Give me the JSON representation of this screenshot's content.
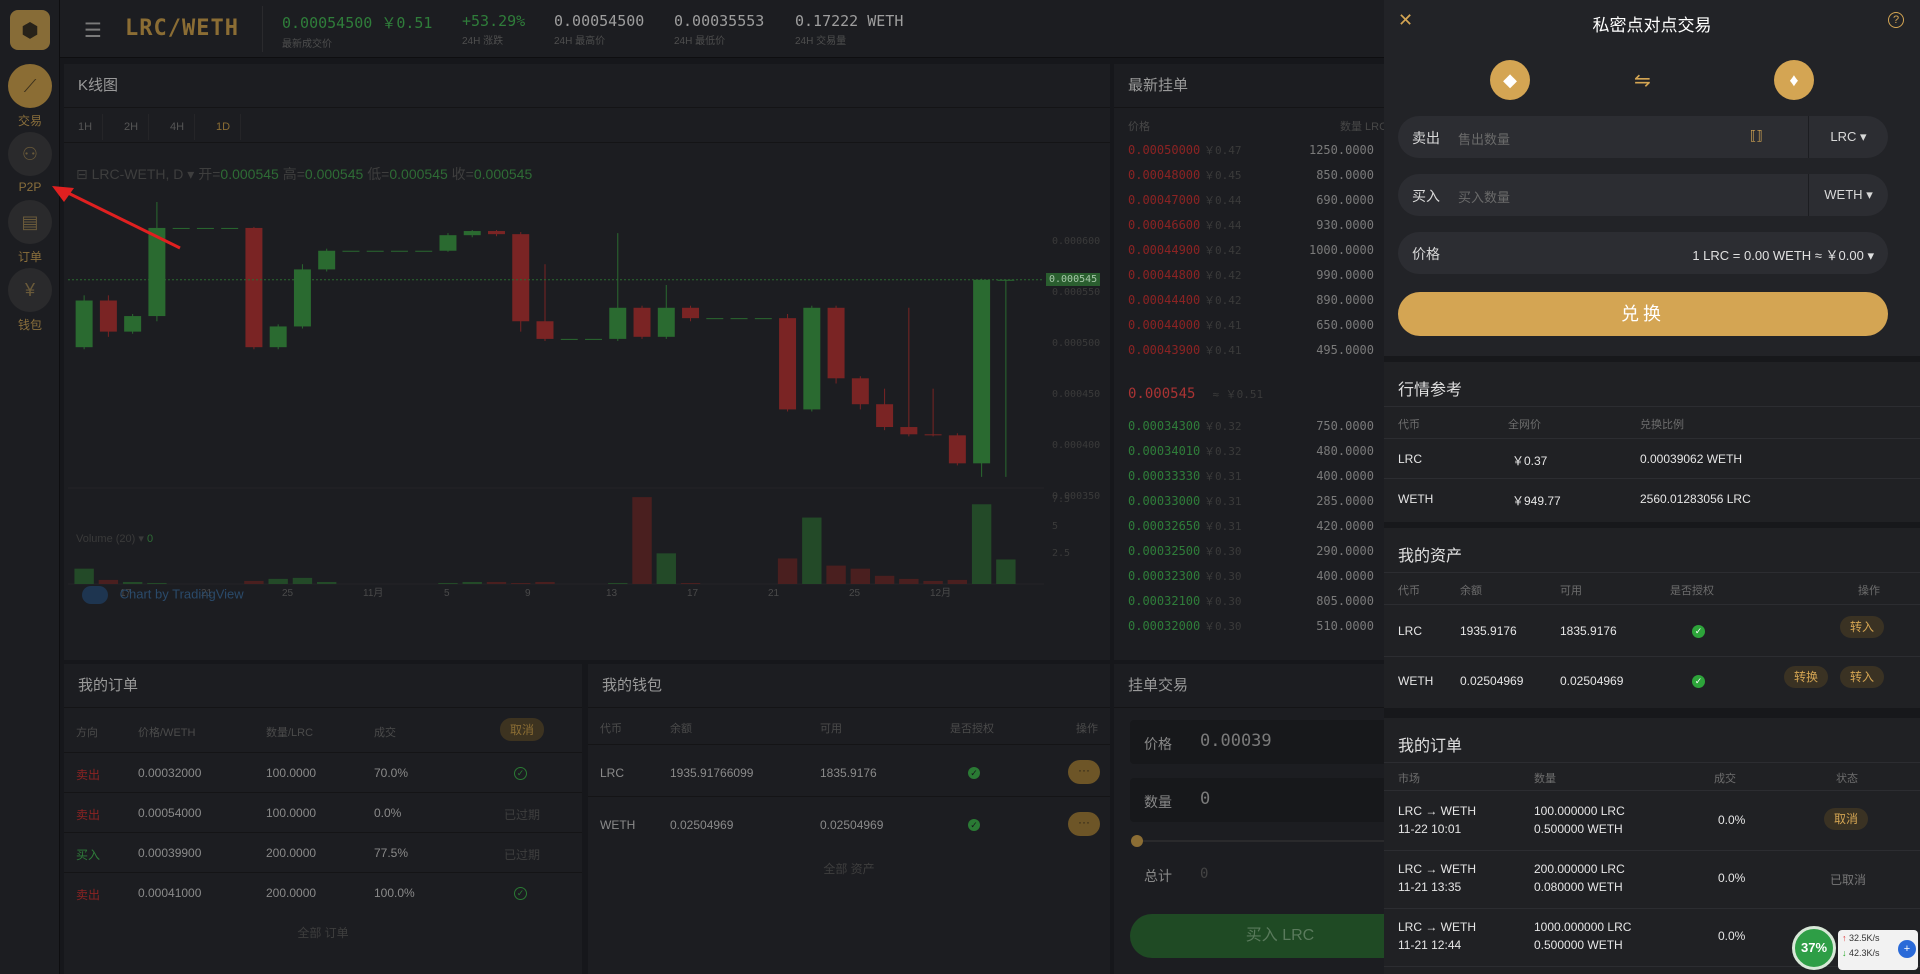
{
  "rail": {
    "items": [
      {
        "label": "交易"
      },
      {
        "label": "P2P"
      },
      {
        "label": "订单"
      },
      {
        "label": "钱包"
      }
    ]
  },
  "topbar": {
    "pair": "LRC/WETH",
    "stats": [
      {
        "value": "0.00054500 ￥0.51",
        "label": "最新成交价"
      },
      {
        "value": "+53.29%",
        "label": "24H 涨跌"
      },
      {
        "value": "0.00054500",
        "label": "24H 最高价"
      },
      {
        "value": "0.00035553",
        "label": "24H 最低价"
      },
      {
        "value": "0.17222 WETH",
        "label": "24H 交易量"
      }
    ]
  },
  "chart": {
    "title": "K线图",
    "timeframes": [
      "1H",
      "2H",
      "4H",
      "1D"
    ],
    "symbol": "LRC-WETH, D",
    "ohlc": {
      "o_label": "开=",
      "o": "0.000545",
      "h_label": "高=",
      "h": "0.000545",
      "l_label": "低=",
      "l": "0.000545",
      "c_label": "收=",
      "c": "0.000545"
    },
    "volume_label": "Volume (20)",
    "volume_value": "0",
    "watermark": "Chart by TradingView",
    "last_price_tag": "0.000545",
    "y_ticks": [
      "0.000600",
      "0.000550",
      "0.000500",
      "0.000450",
      "0.000400",
      "0.000350"
    ],
    "vol_ticks": [
      "7.5",
      "5",
      "2.5"
    ],
    "x_ticks": [
      "17",
      "21",
      "25",
      "11月",
      "5",
      "9",
      "13",
      "17",
      "21",
      "25",
      "12月"
    ]
  },
  "chart_data": {
    "type": "candlestick",
    "ylim": [
      0.00035,
      0.00062
    ],
    "candles": [
      {
        "o": 0.00048,
        "c": 0.000525,
        "h": 0.00053,
        "l": 0.000478
      },
      {
        "o": 0.000525,
        "c": 0.000495,
        "h": 0.00053,
        "l": 0.00049
      },
      {
        "o": 0.000495,
        "c": 0.00051,
        "h": 0.000512,
        "l": 0.000493
      },
      {
        "o": 0.00051,
        "c": 0.000595,
        "h": 0.00062,
        "l": 0.000505
      },
      {
        "o": 0.000595,
        "c": 0.000595,
        "h": 0.000595,
        "l": 0.000595
      },
      {
        "o": 0.000595,
        "c": 0.000595,
        "h": 0.000595,
        "l": 0.000595
      },
      {
        "o": 0.000595,
        "c": 0.000595,
        "h": 0.000595,
        "l": 0.000595
      },
      {
        "o": 0.000595,
        "c": 0.00048,
        "h": 0.000596,
        "l": 0.000478
      },
      {
        "o": 0.00048,
        "c": 0.0005,
        "h": 0.000502,
        "l": 0.000478
      },
      {
        "o": 0.0005,
        "c": 0.000555,
        "h": 0.00056,
        "l": 0.000498
      },
      {
        "o": 0.000555,
        "c": 0.000573,
        "h": 0.000575,
        "l": 0.000553
      },
      {
        "o": 0.000573,
        "c": 0.000573,
        "h": 0.000573,
        "l": 0.000573
      },
      {
        "o": 0.000573,
        "c": 0.000573,
        "h": 0.000573,
        "l": 0.000573
      },
      {
        "o": 0.000573,
        "c": 0.000573,
        "h": 0.000573,
        "l": 0.000573
      },
      {
        "o": 0.000573,
        "c": 0.000573,
        "h": 0.000573,
        "l": 0.000573
      },
      {
        "o": 0.000573,
        "c": 0.000588,
        "h": 0.00059,
        "l": 0.000572
      },
      {
        "o": 0.000588,
        "c": 0.000592,
        "h": 0.000593,
        "l": 0.000586
      },
      {
        "o": 0.000592,
        "c": 0.000589,
        "h": 0.000593,
        "l": 0.000587
      },
      {
        "o": 0.000589,
        "c": 0.000505,
        "h": 0.000591,
        "l": 0.000495
      },
      {
        "o": 0.000505,
        "c": 0.000488,
        "h": 0.00056,
        "l": 0.000486
      },
      {
        "o": 0.000488,
        "c": 0.000488,
        "h": 0.000488,
        "l": 0.000488
      },
      {
        "o": 0.000488,
        "c": 0.000488,
        "h": 0.000488,
        "l": 0.000488
      },
      {
        "o": 0.000488,
        "c": 0.000518,
        "h": 0.00059,
        "l": 0.000486
      },
      {
        "o": 0.000518,
        "c": 0.00049,
        "h": 0.00052,
        "l": 0.000488
      },
      {
        "o": 0.00049,
        "c": 0.000518,
        "h": 0.00054,
        "l": 0.000488
      },
      {
        "o": 0.000518,
        "c": 0.000508,
        "h": 0.00052,
        "l": 0.000505
      },
      {
        "o": 0.000508,
        "c": 0.000508,
        "h": 0.000508,
        "l": 0.000508
      },
      {
        "o": 0.000508,
        "c": 0.000508,
        "h": 0.000508,
        "l": 0.000508
      },
      {
        "o": 0.000508,
        "c": 0.000508,
        "h": 0.000508,
        "l": 0.000508
      },
      {
        "o": 0.000508,
        "c": 0.00042,
        "h": 0.000512,
        "l": 0.000418
      },
      {
        "o": 0.00042,
        "c": 0.000518,
        "h": 0.00052,
        "l": 0.000418
      },
      {
        "o": 0.000518,
        "c": 0.00045,
        "h": 0.00052,
        "l": 0.000445
      },
      {
        "o": 0.00045,
        "c": 0.000425,
        "h": 0.000452,
        "l": 0.00042
      },
      {
        "o": 0.000425,
        "c": 0.000403,
        "h": 0.00044,
        "l": 0.0004
      },
      {
        "o": 0.000403,
        "c": 0.000396,
        "h": 0.000518,
        "l": 0.000394
      },
      {
        "o": 0.000396,
        "c": 0.000395,
        "h": 0.00044,
        "l": 0.000394
      },
      {
        "o": 0.000395,
        "c": 0.000368,
        "h": 0.000397,
        "l": 0.000366
      },
      {
        "o": 0.000368,
        "c": 0.000545,
        "h": 0.000546,
        "l": 0.000355
      },
      {
        "o": 0.000545,
        "c": 0.000545,
        "h": 0.000545,
        "l": 0.000355
      }
    ],
    "volumes": [
      1.5,
      0.4,
      0.2,
      0.1,
      0,
      0,
      0,
      0.3,
      0.5,
      0.6,
      0.2,
      0,
      0,
      0,
      0,
      0.1,
      0.2,
      0.2,
      0.1,
      0.2,
      0,
      0,
      0.1,
      8.5,
      3.0,
      0.1,
      0,
      0,
      0,
      2.5,
      6.5,
      1.8,
      1.5,
      0.8,
      0.5,
      0.3,
      0.4,
      7.8,
      2.4,
      0
    ]
  },
  "book": {
    "title": "最新挂单",
    "col_price": "价格",
    "col_qty": "数量 LRC",
    "asks": [
      {
        "p": "0.00050000",
        "c": "￥0.47",
        "q": "1250.0000"
      },
      {
        "p": "0.00048000",
        "c": "￥0.45",
        "q": "850.0000"
      },
      {
        "p": "0.00047000",
        "c": "￥0.44",
        "q": "690.0000"
      },
      {
        "p": "0.00046600",
        "c": "￥0.44",
        "q": "930.0000"
      },
      {
        "p": "0.00044900",
        "c": "￥0.42",
        "q": "1000.0000"
      },
      {
        "p": "0.00044800",
        "c": "￥0.42",
        "q": "990.0000"
      },
      {
        "p": "0.00044400",
        "c": "￥0.42",
        "q": "890.0000"
      },
      {
        "p": "0.00044000",
        "c": "￥0.41",
        "q": "650.0000"
      },
      {
        "p": "0.00043900",
        "c": "￥0.41",
        "q": "495.0000"
      }
    ],
    "last": {
      "p": "0.000545",
      "c": "≈ ￥0.51"
    },
    "bids": [
      {
        "p": "0.00034300",
        "c": "￥0.32",
        "q": "750.0000"
      },
      {
        "p": "0.00034010",
        "c": "￥0.32",
        "q": "480.0000"
      },
      {
        "p": "0.00033330",
        "c": "￥0.31",
        "q": "400.0000"
      },
      {
        "p": "0.00033000",
        "c": "￥0.31",
        "q": "285.0000"
      },
      {
        "p": "0.00032650",
        "c": "￥0.31",
        "q": "420.0000"
      },
      {
        "p": "0.00032500",
        "c": "￥0.30",
        "q": "290.0000"
      },
      {
        "p": "0.00032300",
        "c": "￥0.30",
        "q": "400.0000"
      },
      {
        "p": "0.00032100",
        "c": "￥0.30",
        "q": "805.0000"
      },
      {
        "p": "0.00032000",
        "c": "￥0.30",
        "q": "510.0000"
      }
    ]
  },
  "myorders": {
    "title": "我的订单",
    "headers": [
      "方向",
      "价格/WETH",
      "数量/LRC",
      "成交"
    ],
    "cancel_all": "取消",
    "rows": [
      {
        "side": "卖出",
        "price": "0.00032000",
        "qty": "100.0000",
        "filled": "70.0%",
        "status": ""
      },
      {
        "side": "卖出",
        "price": "0.00054000",
        "qty": "100.0000",
        "filled": "0.0%",
        "status": "已过期"
      },
      {
        "side": "买入",
        "price": "0.00039900",
        "qty": "200.0000",
        "filled": "77.5%",
        "status": "已过期"
      },
      {
        "side": "卖出",
        "price": "0.00041000",
        "qty": "200.0000",
        "filled": "100.0%",
        "status": ""
      }
    ],
    "footer": "全部 订单"
  },
  "mywallet": {
    "title": "我的钱包",
    "headers": [
      "代币",
      "余额",
      "可用",
      "是否授权",
      "操作"
    ],
    "rows": [
      {
        "token": "LRC",
        "balance": "1935.91766099",
        "available": "1835.9176"
      },
      {
        "token": "WETH",
        "balance": "0.02504969",
        "available": "0.02504969"
      }
    ],
    "footer": "全部 资产"
  },
  "placeorder": {
    "title": "挂单交易",
    "price_label": "价格",
    "price_value": "0.00039",
    "qty_label": "数量",
    "qty_value": "0",
    "total_label": "总计",
    "total_value": "0",
    "buy_label": "买入 LRC"
  },
  "drawer": {
    "title": "私密点对点交易",
    "sell_label": "卖出",
    "sell_placeholder": "售出数量",
    "sell_token": "LRC",
    "buy_label": "买入",
    "buy_placeholder": "买入数量",
    "buy_token": "WETH",
    "price_label": "价格",
    "price_value": "1 LRC = 0.00 WETH ≈ ￥0.00",
    "swap_button": "兑换",
    "market": {
      "title": "行情参考",
      "headers": [
        "代币",
        "全网价",
        "兑换比例"
      ],
      "rows": [
        {
          "token": "LRC",
          "price": "￥0.37",
          "ratio": "0.00039062 WETH"
        },
        {
          "token": "WETH",
          "price": "￥949.77",
          "ratio": "2560.01283056 LRC"
        }
      ]
    },
    "assets": {
      "title": "我的资产",
      "headers": [
        "代币",
        "余额",
        "可用",
        "是否授权",
        "操作"
      ],
      "rows": [
        {
          "token": "LRC",
          "balance": "1935.9176",
          "available": "1835.9176",
          "actions": [
            "转入"
          ]
        },
        {
          "token": "WETH",
          "balance": "0.02504969",
          "available": "0.02504969",
          "actions": [
            "转换",
            "转入"
          ]
        }
      ]
    },
    "orders": {
      "title": "我的订单",
      "headers": [
        "市场",
        "数量",
        "成交",
        "状态"
      ],
      "rows": [
        {
          "market": "LRC → WETH",
          "time": "11-22 10:01",
          "q1": "100.000000 LRC",
          "q2": "0.500000 WETH",
          "filled": "0.0%",
          "status": "取消"
        },
        {
          "market": "LRC → WETH",
          "time": "11-21 13:35",
          "q1": "200.000000 LRC",
          "q2": "0.080000 WETH",
          "filled": "0.0%",
          "status": "已取消"
        },
        {
          "market": "LRC → WETH",
          "time": "11-21 12:44",
          "q1": "1000.000000 LRC",
          "q2": "0.500000 WETH",
          "filled": "0.0%",
          "status": ""
        }
      ]
    }
  },
  "net": {
    "percent": "37%",
    "up": "32.5K/s",
    "down": "42.3K/s"
  },
  "colors": {
    "accent": "#d4a553",
    "up": "#2f7d3a",
    "down": "#8b2323"
  }
}
